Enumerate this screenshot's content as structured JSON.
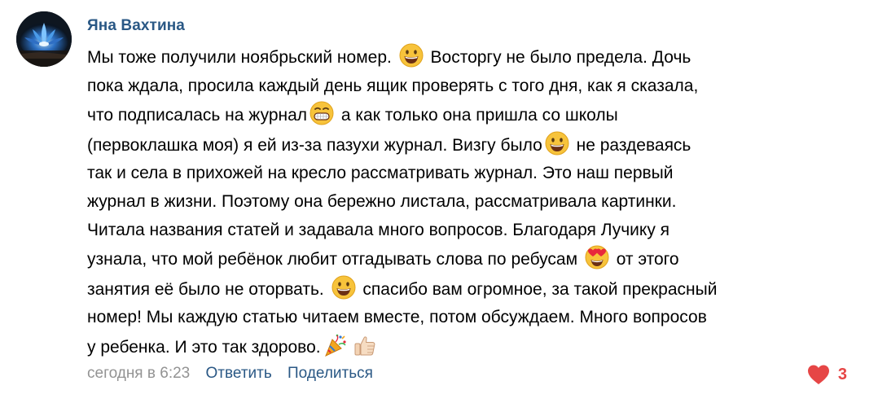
{
  "comment": {
    "author": "Яна Вахтина",
    "avatar_icon": "blue-lotus-flower-avatar",
    "lines": [
      [
        {
          "t": "text",
          "v": "Мы тоже получили ноябрьский номер. "
        },
        {
          "t": "emoji",
          "icon": "grinning-face-emoji"
        },
        {
          "t": "text",
          "v": " Восторгу не было предела. Дочь"
        }
      ],
      [
        {
          "t": "text",
          "v": "пока ждала, просила каждый день ящик проверять с того дня, как я сказала,"
        }
      ],
      [
        {
          "t": "text",
          "v": "что подписалась на журнал"
        },
        {
          "t": "emoji",
          "icon": "grinning-face-teeth-emoji"
        },
        {
          "t": "text",
          "v": " а как только она пришла со школы"
        }
      ],
      [
        {
          "t": "text",
          "v": "(первоклашка моя) я ей из-за пазухи журнал. Визгу было"
        },
        {
          "t": "emoji",
          "icon": "grinning-face-emoji"
        },
        {
          "t": "text",
          "v": " не раздеваясь"
        }
      ],
      [
        {
          "t": "text",
          "v": "так и села в прихожей на кресло рассматривать журнал. Это наш первый"
        }
      ],
      [
        {
          "t": "text",
          "v": "журнал в жизни. Поэтому она бережно листала, рассматривала картинки."
        }
      ],
      [
        {
          "t": "text",
          "v": "Читала названия статей и задавала много вопросов. Благодаря Лучику я"
        }
      ],
      [
        {
          "t": "text",
          "v": "узнала, что мой ребёнок любит отгадывать слова по ребусам "
        },
        {
          "t": "emoji",
          "icon": "heart-eyes-emoji"
        },
        {
          "t": "text",
          "v": " от этого"
        }
      ],
      [
        {
          "t": "text",
          "v": "занятия её было не оторвать. "
        },
        {
          "t": "emoji",
          "icon": "grinning-face-emoji"
        },
        {
          "t": "text",
          "v": " спасибо вам огромное, за такой прекрасный"
        }
      ],
      [
        {
          "t": "text",
          "v": "номер! Мы каждую статью читаем вместе, потом обсуждаем. Много вопросов"
        }
      ],
      [
        {
          "t": "text",
          "v": "у ребенка. И это так здорово."
        },
        {
          "t": "emoji",
          "icon": "party-popper-emoji"
        },
        {
          "t": "emoji",
          "icon": "thumbs-up-emoji"
        }
      ]
    ],
    "date": "сегодня в 6:23",
    "reply_label": "Ответить",
    "share_label": "Поделиться",
    "likes_count": "3"
  },
  "colors": {
    "link": "#2a5885",
    "meta": "#939393",
    "like": "#e64646"
  }
}
